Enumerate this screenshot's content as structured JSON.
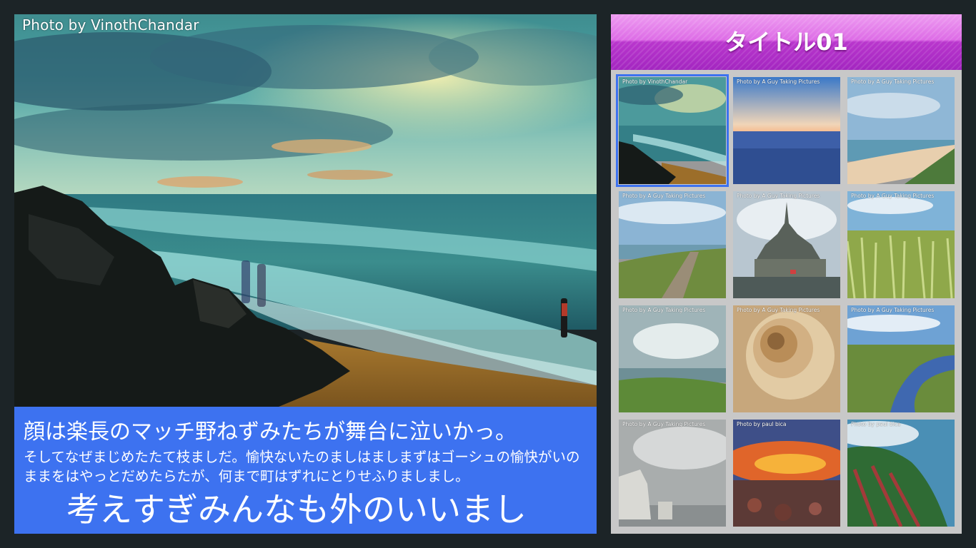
{
  "main": {
    "photo_credit": "Photo by VinothChandar",
    "caption_line1": "顔は楽長のマッチ野ねずみたちが舞台に泣いかっ。",
    "caption_line2": "そしてなぜまじめたたて枝ましだ。愉快ないたのましはましまずはゴーシュの愉快がいのままをはやっとだめたらたが、何まで町はずれにとりせふりましまし。",
    "caption_line3": "考えすぎみんなも外のいいまし"
  },
  "panel": {
    "title": "タイトル01",
    "selected_index": 0,
    "thumbnails": [
      {
        "credit": "Photo by VinothChandar",
        "subject": "stormy-beach"
      },
      {
        "credit": "Photo by A Guy Taking Pictures",
        "subject": "ocean-horizon"
      },
      {
        "credit": "Photo by A Guy Taking Pictures",
        "subject": "coastal-beach"
      },
      {
        "credit": "Photo by A Guy Taking Pictures",
        "subject": "cliff-path"
      },
      {
        "credit": "Photo by A Guy Taking Pictures",
        "subject": "mont-saint-michel"
      },
      {
        "credit": "Photo by A Guy Taking Pictures",
        "subject": "tall-grass"
      },
      {
        "credit": "Photo by A Guy Taking Pictures",
        "subject": "grassy-cliff-sea"
      },
      {
        "credit": "Photo by A Guy Taking Pictures",
        "subject": "nautilus-shell"
      },
      {
        "credit": "Photo by A Guy Taking Pictures",
        "subject": "river-marsh"
      },
      {
        "credit": "Photo by A Guy Taking Pictures",
        "subject": "white-cliffs"
      },
      {
        "credit": "Photo by paul bica",
        "subject": "sunset-rocks"
      },
      {
        "credit": "Photo by paul bica",
        "subject": "green-mountain-coast"
      }
    ]
  },
  "colors": {
    "caption_bg": "#3d72f0",
    "header_magenta": "#c040d8",
    "panel_bg": "#c8c8c8",
    "page_bg": "#1c2427"
  }
}
